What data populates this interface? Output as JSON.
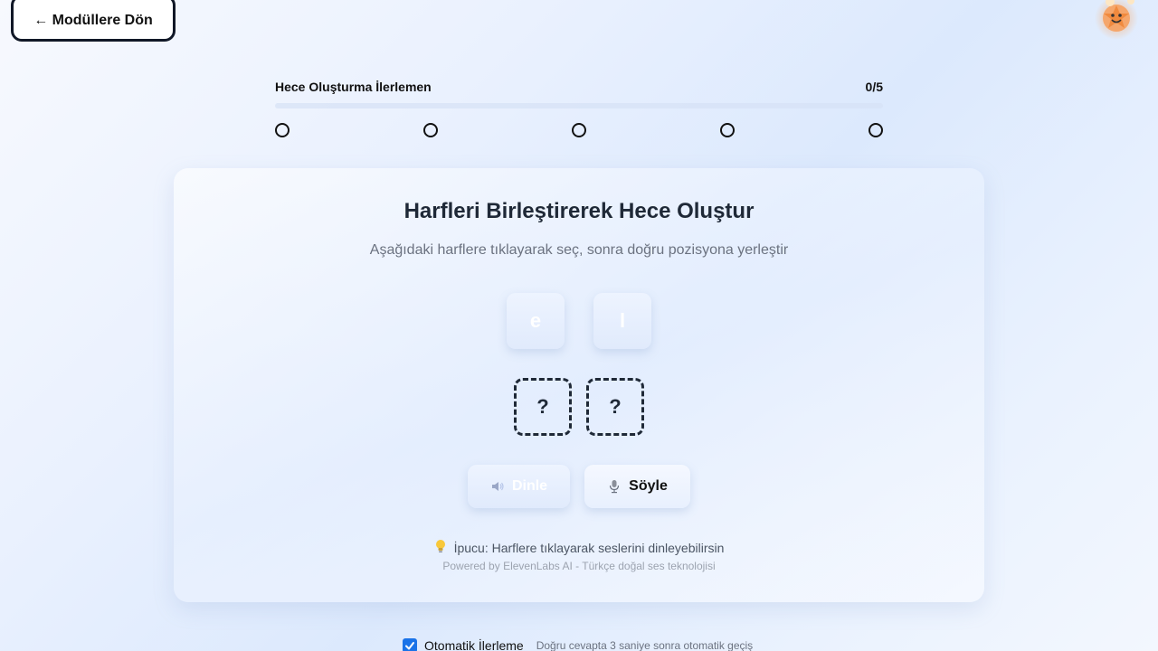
{
  "nav": {
    "back_label": "← Modüllere Dön"
  },
  "mascot": {
    "icon": "smiling-star-mascot-icon"
  },
  "progress": {
    "label": "Hece Oluşturma İlerlemen",
    "count_text": "0/5",
    "completed": 0,
    "total": 5,
    "accent_color": "#4f7cf7"
  },
  "exercise": {
    "title": "Harfleri Birleştirerek Hece Oluştur",
    "instruction": "Aşağıdaki harflere tıklayarak seç, sonra doğru pozisyona yerleştir",
    "letters": [
      "e",
      "l"
    ],
    "slots": [
      "?",
      "?"
    ],
    "listen_label": "Dinle",
    "listen_icon": "speaker-icon",
    "speak_label": "Söyle",
    "speak_icon": "microphone-icon",
    "hint_icon": "lightbulb-icon",
    "hint": "İpucu: Harflere tıklayarak seslerini dinleyebilirsin",
    "powered_by": "Powered by ElevenLabs AI - Türkçe doğal ses teknolojisi"
  },
  "auto_advance": {
    "checked": true,
    "label": "Otomatik İlerleme",
    "description": "Doğru cevapta 3 saniye sonra otomatik geçiş",
    "check_color": "#1a73e8"
  }
}
